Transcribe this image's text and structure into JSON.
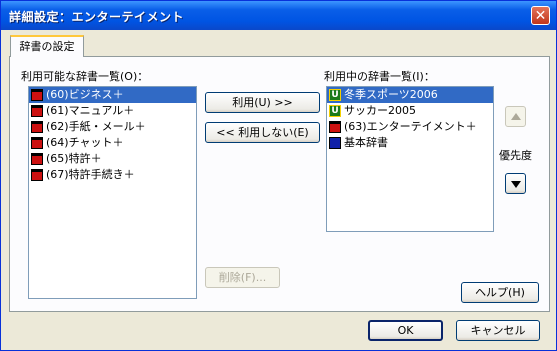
{
  "window": {
    "title": "詳細設定：エンターテイメント",
    "close_glyph": "✕"
  },
  "tab": {
    "label": "辞書の設定"
  },
  "available": {
    "label": "利用可能な辞書一覧(O)：",
    "items": [
      {
        "text": "(60)ビジネス＋",
        "icon": "red-book-icon",
        "selected": true
      },
      {
        "text": "(61)マニュアル＋",
        "icon": "red-book-icon",
        "selected": false
      },
      {
        "text": "(62)手紙・メール＋",
        "icon": "red-book-icon",
        "selected": false
      },
      {
        "text": "(64)チャット＋",
        "icon": "red-book-icon",
        "selected": false
      },
      {
        "text": "(65)特許＋",
        "icon": "red-book-icon",
        "selected": false
      },
      {
        "text": "(67)特許手続き＋",
        "icon": "red-book-icon",
        "selected": false
      }
    ]
  },
  "in_use": {
    "label": "利用中の辞書一覧(I)：",
    "items": [
      {
        "text": "冬季スポーツ2006",
        "icon": "user-dictionary-icon",
        "badge": "U",
        "selected": true
      },
      {
        "text": "サッカー2005",
        "icon": "user-dictionary-icon",
        "badge": "U",
        "selected": false
      },
      {
        "text": "(63)エンターテイメント＋",
        "icon": "red-book-icon",
        "selected": false
      },
      {
        "text": "基本辞書",
        "icon": "blue-book-icon",
        "selected": false
      }
    ]
  },
  "buttons": {
    "use": "利用(U) >>",
    "unuse": "<< 利用しない(E)",
    "delete": "削除(F)...",
    "help": "ヘルプ(H)",
    "ok": "OK",
    "cancel": "キャンセル"
  },
  "priority": {
    "label": "優先度"
  },
  "colors": {
    "titlebar": "#0054e3",
    "selection": "#316ac5",
    "dialog_bg": "#ece9d8"
  }
}
